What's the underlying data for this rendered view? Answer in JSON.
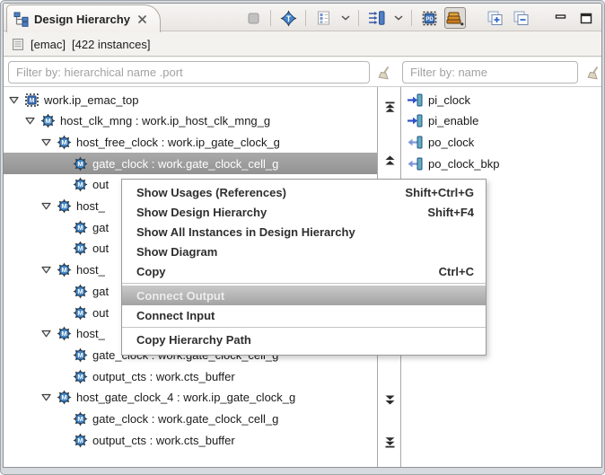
{
  "tab": {
    "title": "Design Hierarchy"
  },
  "toolbar": {
    "icon_names": [
      "pin-disabled-icon",
      "locate-type-icon",
      "view-checklist-icon",
      "chevron-down-icon",
      "sort-options-icon",
      "chevron-down-icon",
      "chip-pd-icon",
      "group-layers-icon",
      "expand-all-icon",
      "collapse-all-icon",
      "minimize-icon",
      "maximize-icon"
    ],
    "pressed_button": "group-layers"
  },
  "info": {
    "unit": "[emac]",
    "count": "[422 instances]"
  },
  "filters": {
    "left_placeholder": "Filter by: hierarchical name .port",
    "right_placeholder": "Filter by: name"
  },
  "tree": {
    "rows": [
      {
        "level": 0,
        "expander": "open",
        "icon": "module",
        "text": "work.ip_emac_top"
      },
      {
        "level": 1,
        "expander": "open",
        "icon": "instance",
        "text": "host_clk_mng : work.ip_host_clk_mng_g"
      },
      {
        "level": 2,
        "expander": "open",
        "icon": "instance",
        "text": "host_free_clock : work.ip_gate_clock_g"
      },
      {
        "level": 3,
        "expander": "none",
        "icon": "instance",
        "text": "gate_clock : work.gate_clock_cell_g",
        "selected": true
      },
      {
        "level": 3,
        "expander": "none",
        "icon": "instance",
        "text": "out"
      },
      {
        "level": 2,
        "expander": "open",
        "icon": "instance",
        "text": "host_"
      },
      {
        "level": 3,
        "expander": "none",
        "icon": "instance",
        "text": "gat"
      },
      {
        "level": 3,
        "expander": "none",
        "icon": "instance",
        "text": "out"
      },
      {
        "level": 2,
        "expander": "open",
        "icon": "instance",
        "text": "host_"
      },
      {
        "level": 3,
        "expander": "none",
        "icon": "instance",
        "text": "gat"
      },
      {
        "level": 3,
        "expander": "none",
        "icon": "instance",
        "text": "out"
      },
      {
        "level": 2,
        "expander": "open",
        "icon": "instance",
        "text": "host_"
      },
      {
        "level": 3,
        "expander": "none",
        "icon": "instance",
        "text": "gate_clock : work.gate_clock_cell_g"
      },
      {
        "level": 3,
        "expander": "none",
        "icon": "instance",
        "text": "output_cts : work.cts_buffer"
      },
      {
        "level": 2,
        "expander": "open",
        "icon": "instance",
        "text": "host_gate_clock_4 : work.ip_gate_clock_g"
      },
      {
        "level": 3,
        "expander": "none",
        "icon": "instance",
        "text": "gate_clock : work.gate_clock_cell_g"
      },
      {
        "level": 3,
        "expander": "none",
        "icon": "instance",
        "text": "output_cts : work.cts_buffer"
      }
    ]
  },
  "ports": {
    "items": [
      {
        "direction": "input",
        "name": "pi_clock"
      },
      {
        "direction": "input",
        "name": "pi_enable"
      },
      {
        "direction": "output",
        "name": "po_clock"
      },
      {
        "direction": "output",
        "name": "po_clock_bkp"
      }
    ]
  },
  "menu": {
    "items": [
      {
        "label": "Show Usages (References)",
        "shortcut": "Shift+Ctrl+G"
      },
      {
        "label": "Show Design Hierarchy",
        "shortcut": "Shift+F4"
      },
      {
        "label": "Show All Instances in Design Hierarchy",
        "shortcut": ""
      },
      {
        "label": "Show Diagram",
        "shortcut": ""
      },
      {
        "label": "Copy",
        "shortcut": "Ctrl+C"
      },
      {
        "type": "separator"
      },
      {
        "label": "Connect Output",
        "shortcut": "",
        "disabled": true,
        "highlighted": true
      },
      {
        "label": "Connect Input",
        "shortcut": ""
      },
      {
        "type": "separator"
      },
      {
        "label": "Copy Hierarchy Path",
        "shortcut": ""
      }
    ]
  },
  "colors": {
    "selection_gray": "#9b9b9b",
    "accent_blue": "#3b6fb0",
    "port_bar_teal": "#62aebe",
    "input_arrow_blue": "#2d52c8",
    "output_arrow_blue": "#7e97d8",
    "layers_orange": "#d88e2a",
    "header_bg": "#f1efec"
  }
}
